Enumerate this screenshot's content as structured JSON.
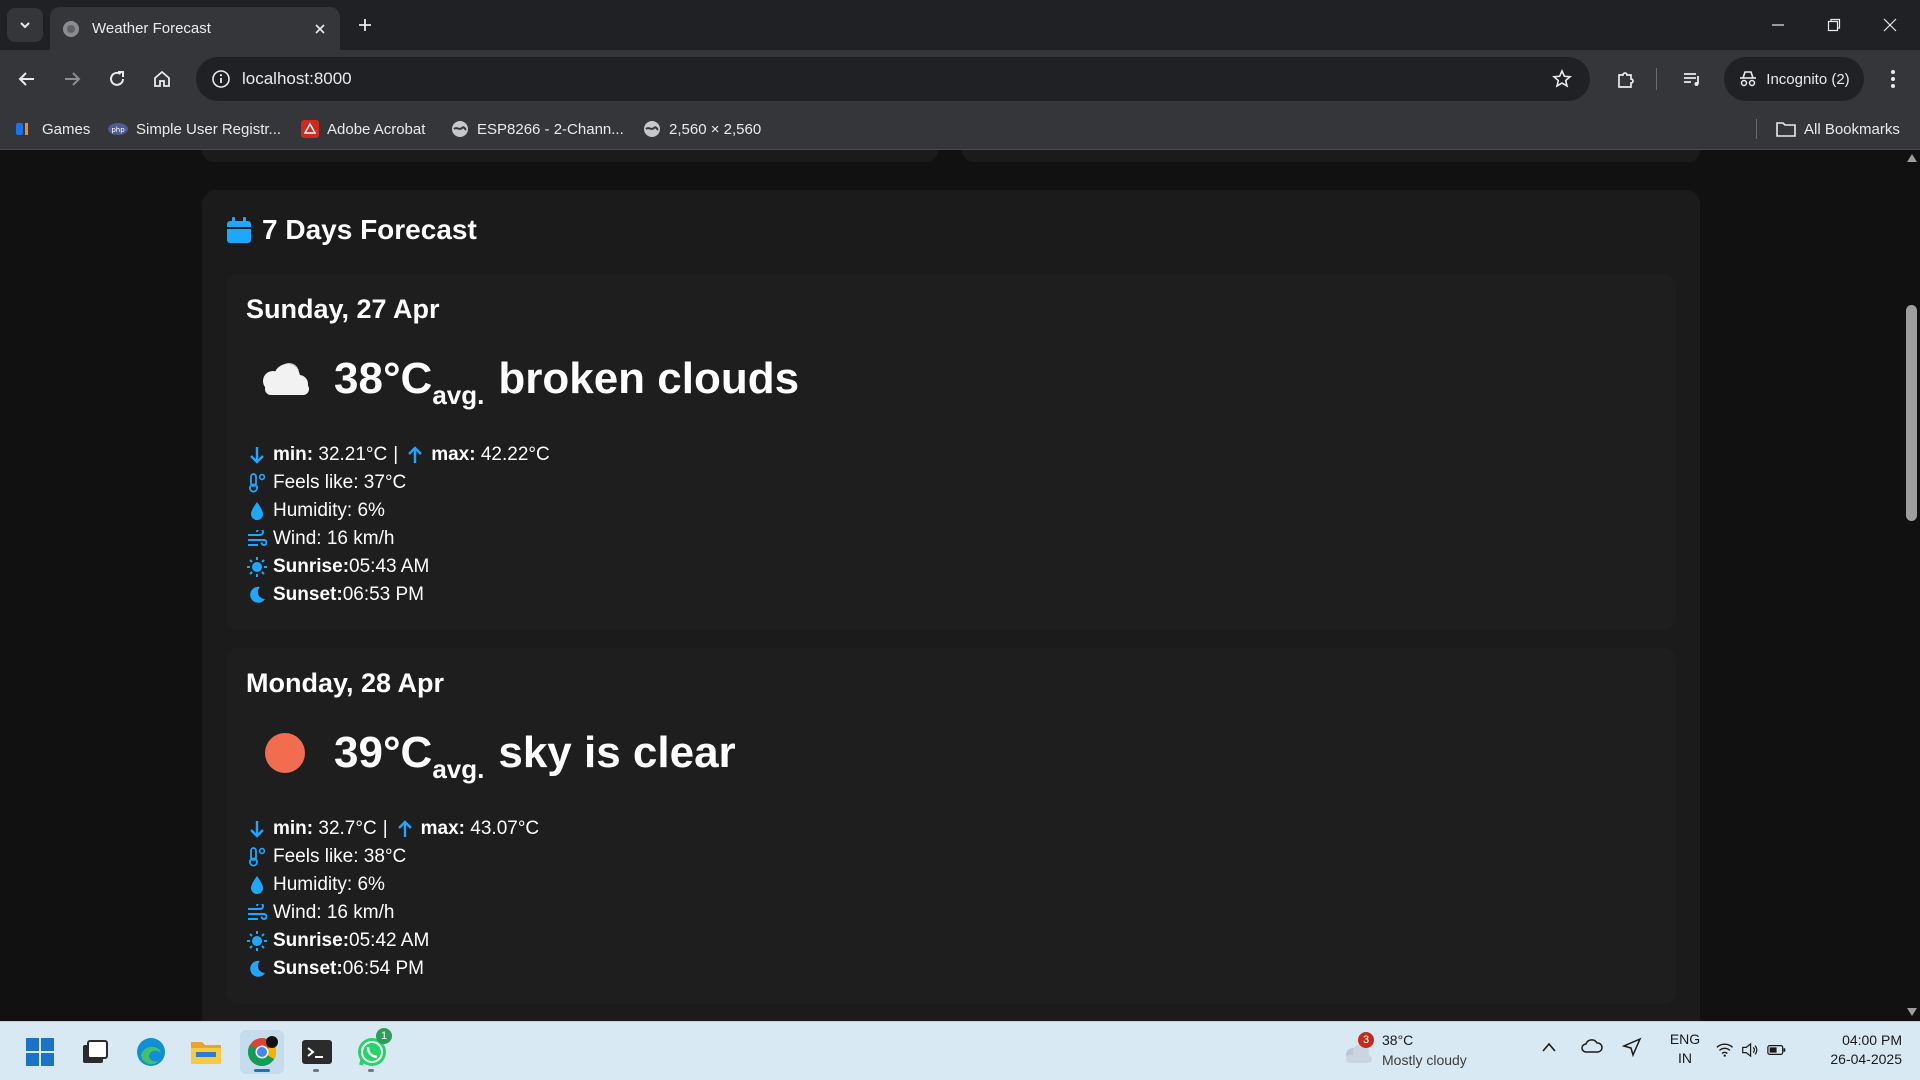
{
  "browser": {
    "tab_title": "Weather Forecast",
    "url": "localhost:8000",
    "incognito_label": "Incognito (2)",
    "bookmarks": [
      {
        "label": "Games",
        "icon": "games-icon"
      },
      {
        "label": "Simple User Registr...",
        "icon": "php-icon"
      },
      {
        "label": "Adobe Acrobat",
        "icon": "acrobat-icon"
      },
      {
        "label": "ESP8266 - 2-Chann...",
        "icon": "globe-icon"
      },
      {
        "label": "2,560 × 2,560",
        "icon": "globe-icon"
      }
    ],
    "all_bookmarks_label": "All Bookmarks"
  },
  "forecast": {
    "section_title": "7 Days Forecast",
    "days": [
      {
        "day": "Sunday, 27 Apr",
        "icon": "broken-clouds-icon",
        "temp": "38°C",
        "avg_label": "avg.",
        "description": "broken clouds",
        "min_label": "min:",
        "min": "32.21°C",
        "max_label": "max:",
        "max": "42.22°C",
        "feels_like": "Feels like: 37°C",
        "humidity": "Humidity: 6%",
        "wind": "Wind: 16 km/h",
        "sunrise_label": "Sunrise:",
        "sunrise": "05:43 AM",
        "sunset_label": "Sunset:",
        "sunset": "06:53 PM"
      },
      {
        "day": "Monday, 28 Apr",
        "icon": "clear-sky-sun-icon",
        "temp": "39°C",
        "avg_label": "avg.",
        "description": "sky is clear",
        "min_label": "min:",
        "min": "32.7°C",
        "max_label": "max:",
        "max": "43.07°C",
        "feels_like": "Feels like: 38°C",
        "humidity": "Humidity: 6%",
        "wind": "Wind: 16 km/h",
        "sunrise_label": "Sunrise:",
        "sunrise": "05:42 AM",
        "sunset_label": "Sunset:",
        "sunset": "06:54 PM"
      }
    ]
  },
  "taskbar": {
    "weather_badge": "3",
    "weather_temp": "38°C",
    "weather_desc": "Mostly cloudy",
    "whatsapp_badge": "1",
    "lang_top": "ENG",
    "lang_bottom": "IN",
    "time": "04:00 PM",
    "date": "26-04-2025"
  },
  "colors": {
    "accent": "#1ea7ff",
    "sun": "#f26c4f",
    "page_bg": "#111111",
    "card_bg": "#1e1e1e"
  }
}
